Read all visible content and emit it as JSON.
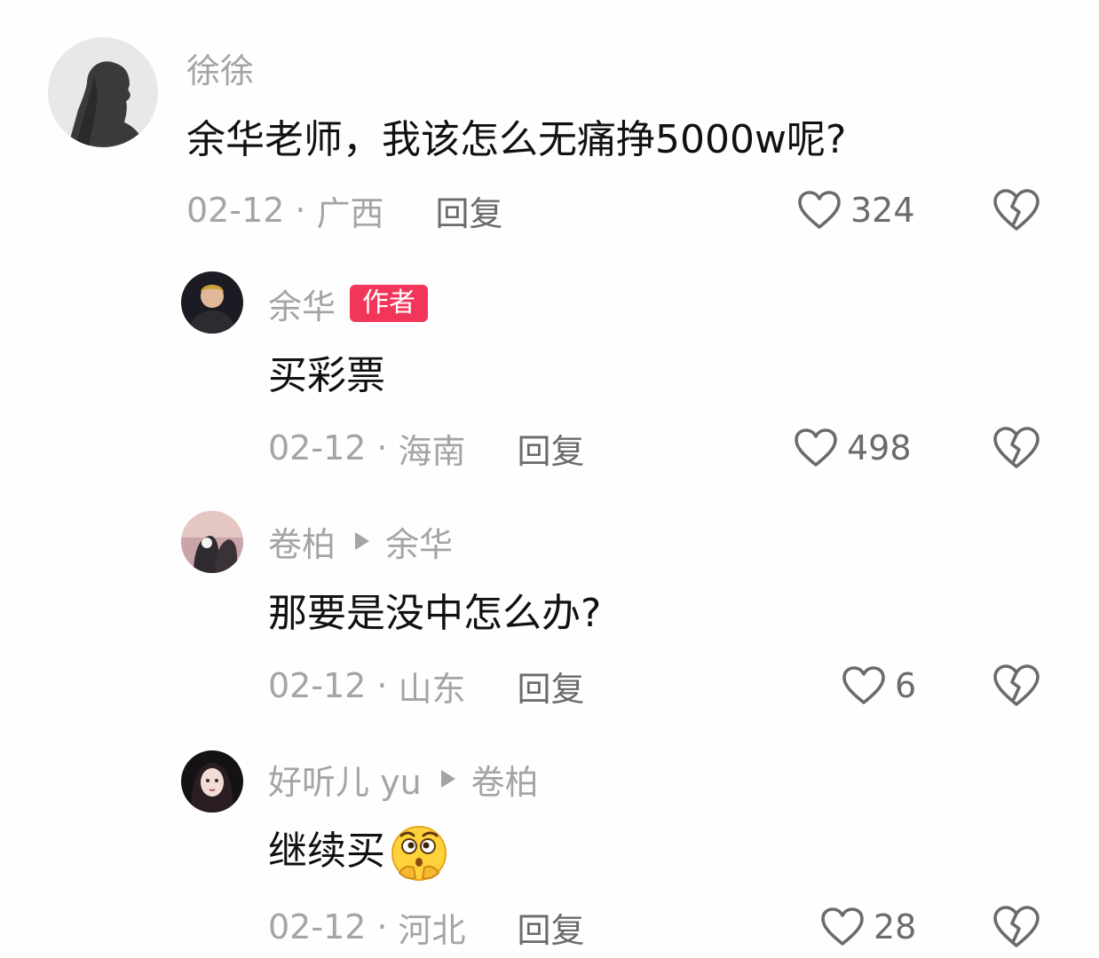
{
  "comments": [
    {
      "username": "徐徐",
      "text": "余华老师，我该怎么无痛挣5000w呢?",
      "date": "02-12",
      "location": "广西",
      "reply_label": "回复",
      "likes": "324"
    },
    {
      "username": "余华",
      "badge": "作者",
      "text": "买彩票",
      "date": "02-12",
      "location": "海南",
      "reply_label": "回复",
      "likes": "498"
    },
    {
      "username": "卷柏",
      "reply_to": "余华",
      "text": "那要是没中怎么办?",
      "date": "02-12",
      "location": "山东",
      "reply_label": "回复",
      "likes": "6"
    },
    {
      "username": "好听儿 yu",
      "reply_to": "卷柏",
      "text": "继续买",
      "emoji": "thinking-shush-emoji",
      "date": "02-12",
      "location": "河北",
      "reply_label": "回复",
      "likes": "28"
    }
  ],
  "separator": "·",
  "icons": {
    "like": "heart-outline-icon",
    "dislike": "broken-heart-icon"
  },
  "colors": {
    "background": "#fefefe",
    "text": "#111111",
    "meta": "#a4a4a6",
    "reply": "#6b6b6d",
    "badge": "#f2365a"
  }
}
